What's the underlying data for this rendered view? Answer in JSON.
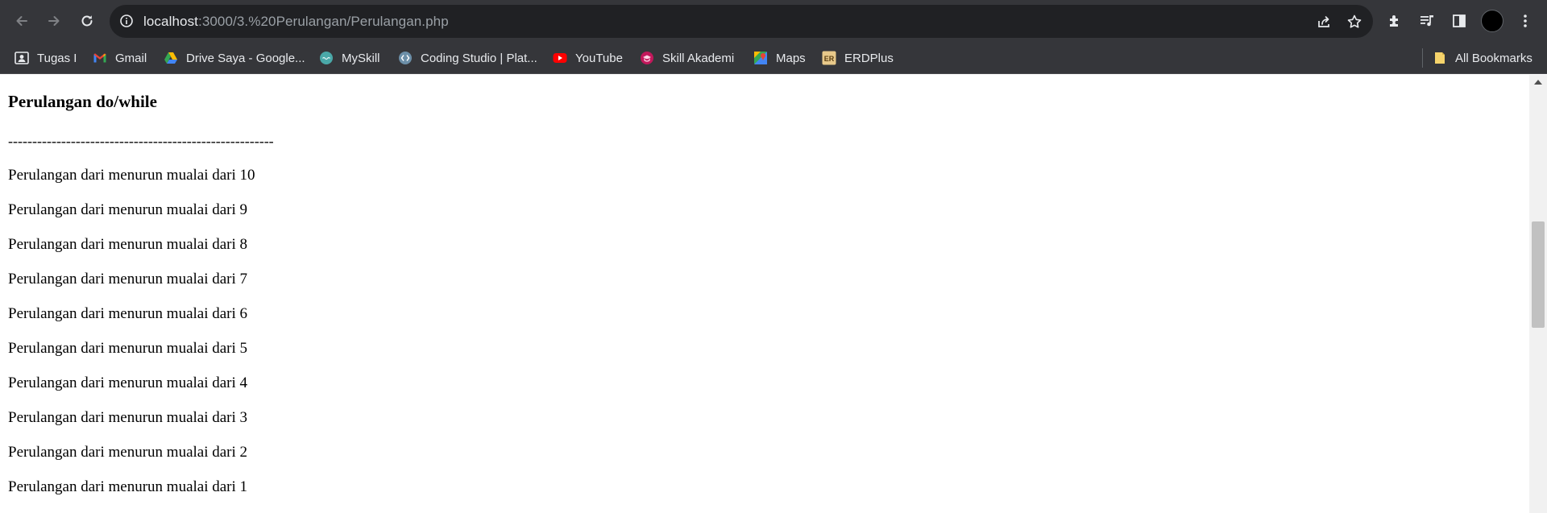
{
  "browser": {
    "url_host": "localhost",
    "url_rest": ":3000/3.%20Perulangan/Perulangan.php"
  },
  "bookmarks": [
    {
      "label": "Tugas I",
      "icon": "person-card-icon"
    },
    {
      "label": "Gmail",
      "icon": "gmail-icon"
    },
    {
      "label": "Drive Saya - Google...",
      "icon": "google-drive-icon"
    },
    {
      "label": "MySkill",
      "icon": "myskill-icon"
    },
    {
      "label": "Coding Studio | Plat...",
      "icon": "coding-studio-icon"
    },
    {
      "label": "YouTube",
      "icon": "youtube-icon"
    },
    {
      "label": "Skill Akademi",
      "icon": "skill-akademi-icon"
    },
    {
      "label": "Maps",
      "icon": "google-maps-icon"
    },
    {
      "label": "ERDPlus",
      "icon": "erdplus-icon"
    }
  ],
  "all_bookmarks_label": "All Bookmarks",
  "page": {
    "heading": "Perulangan do/while",
    "divider": "-------------------------------------------------------",
    "lines": [
      "Perulangan dari menurun mualai dari 10",
      "Perulangan dari menurun mualai dari 9",
      "Perulangan dari menurun mualai dari 8",
      "Perulangan dari menurun mualai dari 7",
      "Perulangan dari menurun mualai dari 6",
      "Perulangan dari menurun mualai dari 5",
      "Perulangan dari menurun mualai dari 4",
      "Perulangan dari menurun mualai dari 3",
      "Perulangan dari menurun mualai dari 2",
      "Perulangan dari menurun mualai dari 1"
    ]
  },
  "colors": {
    "chrome_bg": "#35363a",
    "omnibox_bg": "#202124",
    "icon": "#e8eaed",
    "icon_disabled": "#7f8185",
    "youtube_red": "#ff0000",
    "erd_bg": "#e8c98a"
  }
}
